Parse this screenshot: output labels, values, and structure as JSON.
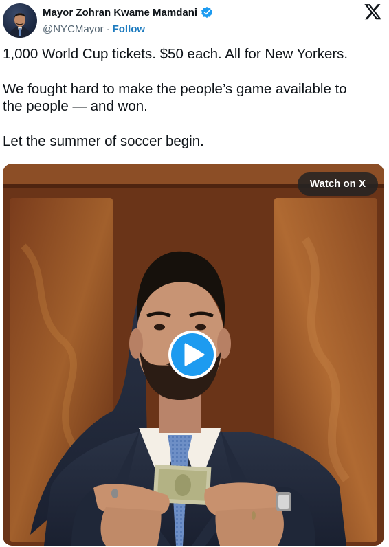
{
  "author": {
    "name": "Mayor Zohran Kwame Mamdani",
    "handle": "@NYCMayor",
    "separator": "·",
    "follow_label": "Follow"
  },
  "tweet": {
    "paragraphs": [
      "1,000 World Cup tickets. $50 each. All for New Yorkers.",
      "We fought hard to make the people’s game available to",
      "the people — and won.",
      "Let the summer of soccer begin."
    ]
  },
  "media": {
    "watch_label": "Watch on X"
  },
  "icons": {
    "verified": "verified-badge-icon",
    "platform": "x-logo-icon",
    "play": "play-icon"
  },
  "colors": {
    "accent": "#1d9bf0",
    "follow": "#1d7bbf",
    "muted": "#536471",
    "text": "#0f1419"
  }
}
